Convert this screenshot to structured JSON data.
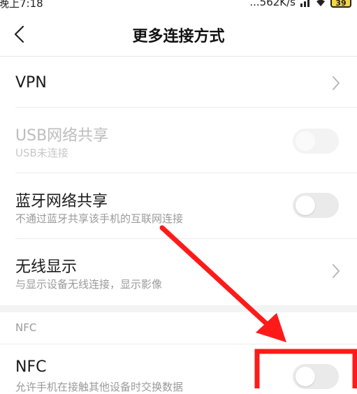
{
  "status_bar": {
    "time": "晚上7:18",
    "network_speed": "...562K/s",
    "battery_level": "39"
  },
  "header": {
    "title": "更多连接方式"
  },
  "settings": {
    "vpn": {
      "title": "VPN"
    },
    "usb_tethering": {
      "title": "USB网络共享",
      "subtitle": "USB未连接",
      "enabled": false,
      "on": false
    },
    "bluetooth_tethering": {
      "title": "蓝牙网络共享",
      "subtitle": "不通过蓝牙共享该手机的互联网连接",
      "on": false
    },
    "wireless_display": {
      "title": "无线显示",
      "subtitle": "与显示设备无线连接，显示影像"
    },
    "nfc_section_header": "NFC",
    "nfc": {
      "title": "NFC",
      "subtitle": "允许手机在接触其他设备时交换数据",
      "on": false
    }
  },
  "colors": {
    "annotation_red": "#ff1a1a",
    "toggle_off": "#eaeaea",
    "section_gap": "#f3f3f3"
  }
}
